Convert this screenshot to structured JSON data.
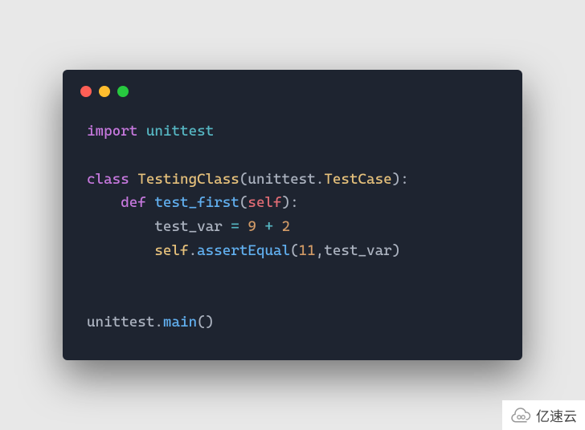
{
  "code": {
    "lines": [
      {
        "kind": "import",
        "kw_import": "import",
        "module": "unittest"
      },
      {
        "kind": "blank"
      },
      {
        "kind": "class",
        "kw_class": "class",
        "classname": "TestingClass",
        "base_module": "unittest",
        "base_attr": "TestCase"
      },
      {
        "kind": "def",
        "indent": "    ",
        "kw_def": "def",
        "funcname": "test_first",
        "param": "self"
      },
      {
        "kind": "assign",
        "indent": "        ",
        "var": "test_var",
        "op_assign": "=",
        "num_a": "9",
        "op_plus": "+",
        "num_b": "2"
      },
      {
        "kind": "assert",
        "indent": "        ",
        "self": "self",
        "method": "assertEqual",
        "arg_num": "11",
        "arg_var": "test_var"
      },
      {
        "kind": "blank"
      },
      {
        "kind": "blank"
      },
      {
        "kind": "call",
        "obj": "unittest",
        "method": "main"
      }
    ]
  },
  "window": {
    "dots": [
      "red",
      "yellow",
      "green"
    ]
  },
  "watermark": {
    "text": "亿速云"
  }
}
